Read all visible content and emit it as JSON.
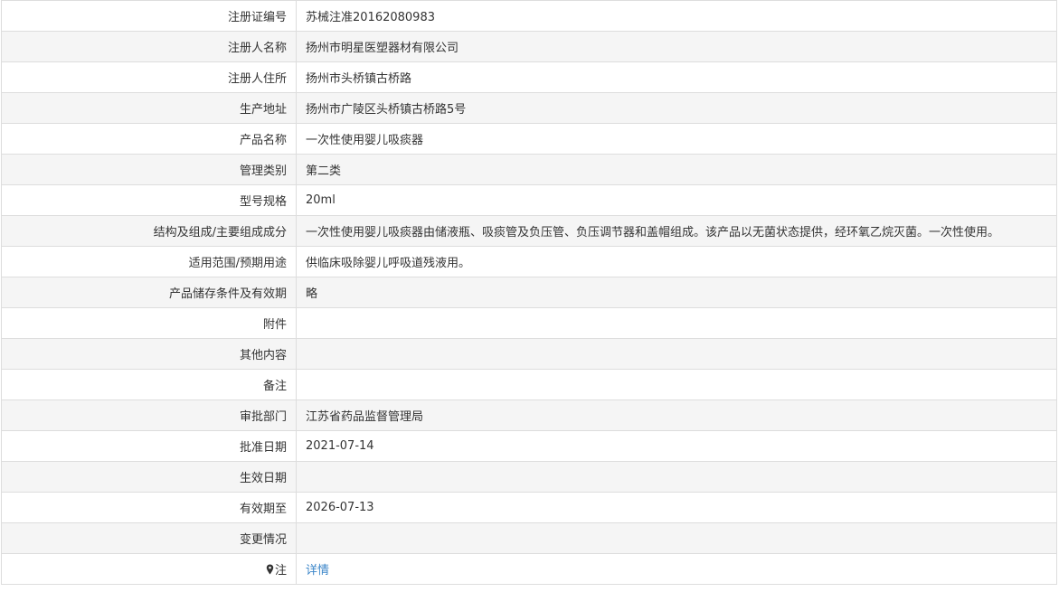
{
  "rows": [
    {
      "label": "注册证编号",
      "value": "苏械注准20162080983"
    },
    {
      "label": "注册人名称",
      "value": "扬州市明星医塑器材有限公司"
    },
    {
      "label": "注册人住所",
      "value": "扬州市头桥镇古桥路"
    },
    {
      "label": "生产地址",
      "value": "扬州市广陵区头桥镇古桥路5号"
    },
    {
      "label": "产品名称",
      "value": "一次性使用婴儿吸痰器"
    },
    {
      "label": "管理类别",
      "value": "第二类"
    },
    {
      "label": "型号规格",
      "value": "20ml"
    },
    {
      "label": "结构及组成/主要组成成分",
      "value": "一次性使用婴儿吸痰器由储液瓶、吸痰管及负压管、负压调节器和盖帽组成。该产品以无菌状态提供，经环氧乙烷灭菌。一次性使用。"
    },
    {
      "label": "适用范围/预期用途",
      "value": "供临床吸除婴儿呼吸道残液用。"
    },
    {
      "label": "产品储存条件及有效期",
      "value": "略"
    },
    {
      "label": "附件",
      "value": ""
    },
    {
      "label": "其他内容",
      "value": ""
    },
    {
      "label": "备注",
      "value": ""
    },
    {
      "label": "审批部门",
      "value": "江苏省药品监督管理局"
    },
    {
      "label": "批准日期",
      "value": "2021-07-14"
    },
    {
      "label": "生效日期",
      "value": ""
    },
    {
      "label": "有效期至",
      "value": "2026-07-13"
    },
    {
      "label": "变更情况",
      "value": ""
    }
  ],
  "note_row": {
    "icon": "map-pin-icon",
    "label": "注",
    "link_text": "详情",
    "link_color": "#3b86c9"
  }
}
